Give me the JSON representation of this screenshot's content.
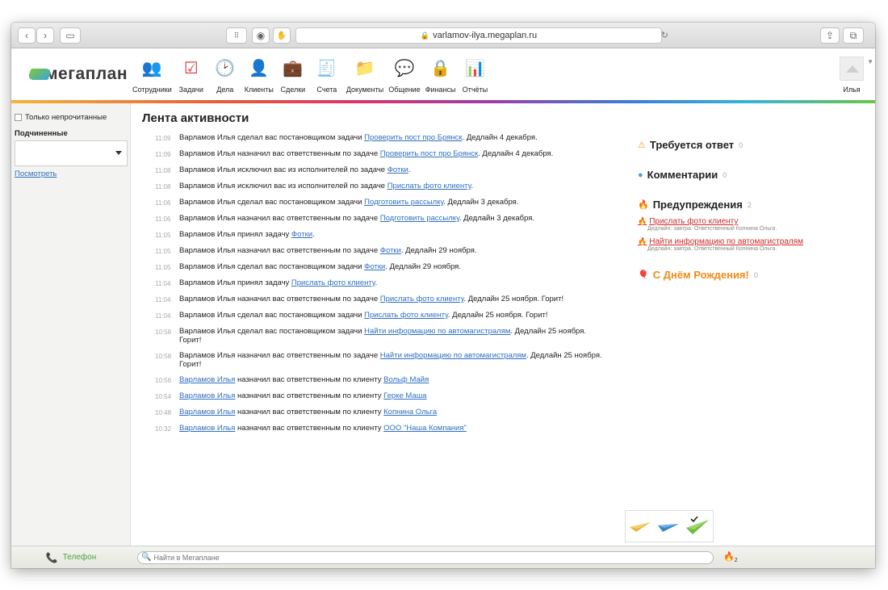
{
  "browser": {
    "url": "varlamov-ilya.megaplan.ru"
  },
  "app": {
    "logo_text": "мегаплан",
    "nav": [
      {
        "label": "Сотрудники",
        "icon": "employees-icon",
        "glyph": "👥",
        "color": "#8ab83a"
      },
      {
        "label": "Задачи",
        "icon": "tasks-icon",
        "glyph": "☑",
        "color": "#d8323a"
      },
      {
        "label": "Дела",
        "icon": "clock-icon",
        "glyph": "🕑",
        "color": "#4c90d8"
      },
      {
        "label": "Клиенты",
        "icon": "clients-icon",
        "glyph": "👤",
        "color": "#2f4f8a"
      },
      {
        "label": "Сделки",
        "icon": "deals-icon",
        "glyph": "💼",
        "color": "#8a5a2b"
      },
      {
        "label": "Счета",
        "icon": "invoices-icon",
        "glyph": "🧾",
        "color": "#5aa0c8"
      },
      {
        "label": "Документы",
        "icon": "documents-icon",
        "glyph": "📁",
        "color": "#e8a73a"
      },
      {
        "label": "Общение",
        "icon": "chat-icon",
        "glyph": "💬",
        "color": "#7cc440"
      },
      {
        "label": "Финансы",
        "icon": "safe-icon",
        "glyph": "🔒",
        "color": "#555555"
      },
      {
        "label": "Отчёты",
        "icon": "reports-icon",
        "glyph": "📊",
        "color": "#d8323a"
      }
    ],
    "user_name": "Илья"
  },
  "sidebar": {
    "unread_only": "Только непрочитанные",
    "subordinates_label": "Подчиненные",
    "view_link": "Посмотреть"
  },
  "content": {
    "title": "Лента активности",
    "feed": [
      {
        "time": "11:09",
        "parts": [
          [
            "t",
            "Варламов Илья сделал вас постановщиком задачи "
          ],
          [
            "a",
            "Проверить пост про Брянск"
          ],
          [
            "t",
            ". Дедлайн 4 декабря."
          ]
        ]
      },
      {
        "time": "11:09",
        "parts": [
          [
            "t",
            "Варламов Илья назначил вас ответственным по задаче "
          ],
          [
            "a",
            "Проверить пост про Брянск"
          ],
          [
            "t",
            ". Дедлайн 4 декабря."
          ]
        ]
      },
      {
        "time": "11:08",
        "parts": [
          [
            "t",
            "Варламов Илья исключил вас из исполнителей по задаче "
          ],
          [
            "a",
            "Фотки"
          ],
          [
            "t",
            "."
          ]
        ]
      },
      {
        "time": "11:08",
        "parts": [
          [
            "t",
            "Варламов Илья исключил вас из исполнителей по задаче "
          ],
          [
            "a",
            "Прислать фото клиенту"
          ],
          [
            "t",
            "."
          ]
        ]
      },
      {
        "time": "11:06",
        "parts": [
          [
            "t",
            "Варламов Илья сделал вас постановщиком задачи "
          ],
          [
            "a",
            "Подготовить рассылку"
          ],
          [
            "t",
            ". Дедлайн 3 декабря."
          ]
        ]
      },
      {
        "time": "11:06",
        "parts": [
          [
            "t",
            "Варламов Илья назначил вас ответственным по задаче "
          ],
          [
            "a",
            "Подготовить рассылку"
          ],
          [
            "t",
            ". Дедлайн 3 декабря."
          ]
        ]
      },
      {
        "time": "11:05",
        "parts": [
          [
            "t",
            "Варламов Илья принял задачу "
          ],
          [
            "a",
            "Фотки"
          ],
          [
            "t",
            "."
          ]
        ]
      },
      {
        "time": "11:05",
        "parts": [
          [
            "t",
            "Варламов Илья назначил вас ответственным по задаче "
          ],
          [
            "a",
            "Фотки"
          ],
          [
            "t",
            ". Дедлайн 29 ноября."
          ]
        ]
      },
      {
        "time": "11:05",
        "parts": [
          [
            "t",
            "Варламов Илья сделал вас постановщиком задачи "
          ],
          [
            "a",
            "Фотки"
          ],
          [
            "t",
            ". Дедлайн 29 ноября."
          ]
        ]
      },
      {
        "time": "11:04",
        "parts": [
          [
            "t",
            "Варламов Илья принял задачу "
          ],
          [
            "a",
            "Прислать фото клиенту"
          ],
          [
            "t",
            "."
          ]
        ]
      },
      {
        "time": "11:04",
        "parts": [
          [
            "t",
            "Варламов Илья назначил вас ответственным по задаче "
          ],
          [
            "a",
            "Прислать фото клиенту"
          ],
          [
            "t",
            ". Дедлайн 25 ноября. Горит!"
          ]
        ]
      },
      {
        "time": "11:04",
        "parts": [
          [
            "t",
            "Варламов Илья сделал вас постановщиком задачи "
          ],
          [
            "a",
            "Прислать фото клиенту"
          ],
          [
            "t",
            ". Дедлайн 25 ноября. Горит!"
          ]
        ]
      },
      {
        "time": "10:58",
        "parts": [
          [
            "t",
            "Варламов Илья сделал вас постановщиком задачи "
          ],
          [
            "a",
            "Найти информацию по автомагистралям"
          ],
          [
            "t",
            ". Дедлайн 25 ноября. Горит!"
          ]
        ]
      },
      {
        "time": "10:58",
        "parts": [
          [
            "t",
            "Варламов Илья назначил вас ответственным по задаче "
          ],
          [
            "a",
            "Найти информацию по автомагистралям"
          ],
          [
            "t",
            ". Дедлайн 25 ноября. Горит!"
          ]
        ]
      },
      {
        "time": "10:56",
        "parts": [
          [
            "a",
            "Варламов Илья"
          ],
          [
            "t",
            " назначил вас ответственным по клиенту "
          ],
          [
            "a",
            "Вольф Майя"
          ]
        ]
      },
      {
        "time": "10:54",
        "parts": [
          [
            "a",
            "Варламов Илья"
          ],
          [
            "t",
            " назначил вас ответственным по клиенту "
          ],
          [
            "a",
            "Герке Маша"
          ]
        ]
      },
      {
        "time": "10:48",
        "parts": [
          [
            "a",
            "Варламов Илья"
          ],
          [
            "t",
            " назначил вас ответственным по клиенту "
          ],
          [
            "a",
            "Копнина Ольга"
          ]
        ]
      },
      {
        "time": "10:32",
        "parts": [
          [
            "a",
            "Варламов Илья"
          ],
          [
            "t",
            " назначил вас ответственным по клиенту "
          ],
          [
            "a",
            "ООО \"Наша Компания\""
          ]
        ]
      }
    ]
  },
  "right_panel": {
    "reply": {
      "title": "Требуется ответ",
      "count": "0"
    },
    "comments": {
      "title": "Комментарии",
      "count": "0"
    },
    "warnings": {
      "title": "Предупреждения",
      "count": "2",
      "items": [
        {
          "link": "Прислать фото клиенту",
          "sub": "Дедлайн: завтра. Ответственный Копнина Ольга."
        },
        {
          "link": "Найти информацию по автомагистралям",
          "sub": "Дедлайн: завтра. Ответственный Копнина Ольга."
        }
      ]
    },
    "birthday": {
      "title": "С Днём Рождения!",
      "count": "0"
    }
  },
  "bottom": {
    "phone": "Телефон",
    "search_placeholder": "Найти в Мегаплане",
    "fire_count": "2"
  },
  "colors": {
    "link": "#2f6fc0",
    "warning": "#d02b2b",
    "birthday": "#ef8c16",
    "phone": "#4aa436"
  }
}
